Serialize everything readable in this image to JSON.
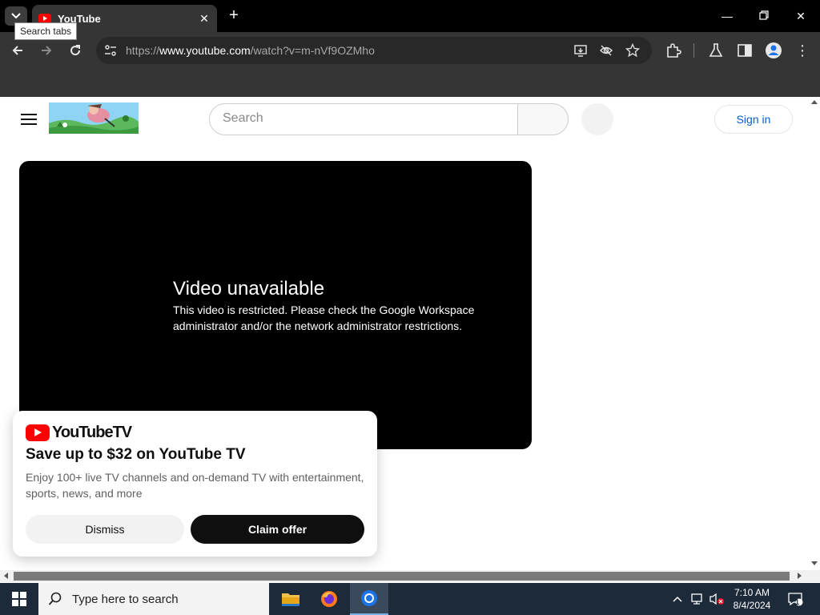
{
  "browser": {
    "tab_title": "YouTube",
    "tooltip": "Search tabs",
    "url_prefix": "https://",
    "url_host": "www.youtube.com",
    "url_path": "/watch?v=m-nVf9OZMho"
  },
  "youtube": {
    "search_placeholder": "Search",
    "sign_in_label": "Sign in",
    "player": {
      "error_title": "Video unavailable",
      "error_message": "This video is restricted. Please check the Google Workspace administrator and/or the network administrator restrictions."
    },
    "promo": {
      "logo_text": "YouTubeTV",
      "headline": "Save up to $32 on YouTube TV",
      "description": "Enjoy 100+ live TV channels and on-demand TV with entertainment, sports, news, and more",
      "dismiss_label": "Dismiss",
      "claim_label": "Claim offer"
    }
  },
  "taskbar": {
    "search_placeholder": "Type here to search",
    "time": "7:10 AM",
    "date": "8/4/2024",
    "notification_count": "1"
  },
  "colors": {
    "youtube_red": "#ff0000",
    "link_blue": "#065fd4",
    "chrome_dark": "#353535",
    "taskbar": "#1c2a3a"
  }
}
